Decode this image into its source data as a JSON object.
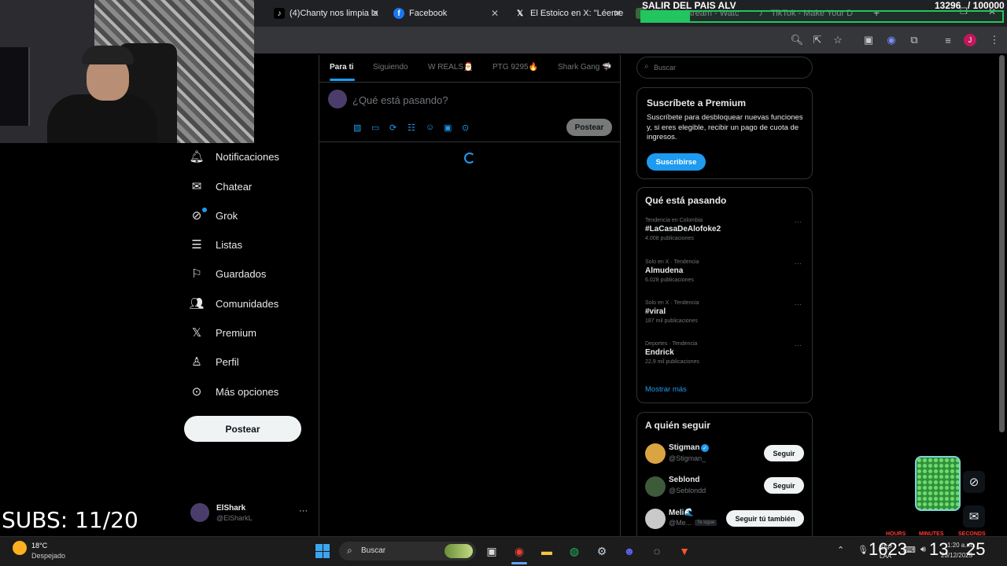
{
  "browser": {
    "tabs": [
      {
        "label": "(4)Chanty nos limpia la",
        "icon": "tiktok-icon"
      },
      {
        "label": "Facebook",
        "icon": "facebook-icon"
      },
      {
        "label": "El Estoico en X: \"Léeme",
        "icon": "x-icon"
      },
      {
        "label": "ElShark Stream - Watc",
        "icon": "stream-icon"
      },
      {
        "label": "TikTok - Make Your D",
        "icon": "tiktok-icon"
      }
    ]
  },
  "overlay": {
    "goal_title": "SALIR DEL PAIS ALV",
    "goal_count": "13296",
    "goal_target": "/ 100000",
    "subs": "SUBS: 11/20",
    "timer": {
      "hours": "1623",
      "minutes": "13",
      "seconds": "25",
      "hours_label": "HOURS",
      "minutes_label": "MINUTES",
      "seconds_label": "SECONDS"
    }
  },
  "nav": {
    "items": [
      {
        "label": "Notificaciones",
        "icon": "bell-icon"
      },
      {
        "label": "Chatear",
        "icon": "mail-icon"
      },
      {
        "label": "Grok",
        "icon": "grok-icon"
      },
      {
        "label": "Listas",
        "icon": "list-icon"
      },
      {
        "label": "Guardados",
        "icon": "bookmark-icon"
      },
      {
        "label": "Comunidades",
        "icon": "people-icon"
      },
      {
        "label": "Premium",
        "icon": "x-logo-icon"
      },
      {
        "label": "Perfil",
        "icon": "person-icon"
      },
      {
        "label": "Más opciones",
        "icon": "more-icon"
      }
    ],
    "post_button": "Postear",
    "account": {
      "name": "ElShark",
      "handle": "@ElSharkL"
    }
  },
  "feed": {
    "tabs": [
      "Para ti",
      "Siguiendo",
      "W REALS🎅",
      "PTG 9295🔥",
      "Shark Gang 🦈"
    ],
    "compose_placeholder": "¿Qué está pasando?",
    "compose_button": "Postear"
  },
  "sidebar": {
    "search_placeholder": "Buscar",
    "premium": {
      "title": "Suscríbete a Premium",
      "text": "Suscríbete para desbloquear nuevas funciones y, si eres elegible, recibir un pago de cuota de ingresos.",
      "button": "Suscribirse"
    },
    "trends_title": "Qué está pasando",
    "trends": [
      {
        "meta": "Tendencia en Colombia",
        "name": "#LaCasaDeAlofoke2",
        "count": "4.008 publicaciones"
      },
      {
        "meta": "Solo en X · Tendencia",
        "name": "Almudena",
        "count": "6.028 publicaciones"
      },
      {
        "meta": "Solo en X · Tendencia",
        "name": "#viral",
        "count": "187 mil publicaciones"
      },
      {
        "meta": "Deportes · Tendencia",
        "name": "Endrick",
        "count": "22,9 mil publicaciones"
      }
    ],
    "show_more": "Mostrar más",
    "who_to_follow_title": "A quién seguir",
    "follow": [
      {
        "name": "Stigman",
        "handle": "@Stigman_",
        "button": "Seguir",
        "verified": true
      },
      {
        "name": "Seblond",
        "handle": "@Seblondd",
        "button": "Seguir",
        "verified": false
      },
      {
        "name": "Meli🌊",
        "handle": "@Me...",
        "badge": "Te sigue",
        "button": "Seguir tú también",
        "verified": false
      }
    ]
  },
  "taskbar": {
    "weather_temp": "18°C",
    "weather_desc": "Despejado",
    "search": "Buscar",
    "lang": "ESP",
    "lang_sub": "LAA",
    "time": "1:20 a.m.",
    "date": "23/12/2025"
  },
  "colors": {
    "accent": "#1d9bf0",
    "goal_green": "#22c55e",
    "timer_red": "#ff3b3b"
  }
}
